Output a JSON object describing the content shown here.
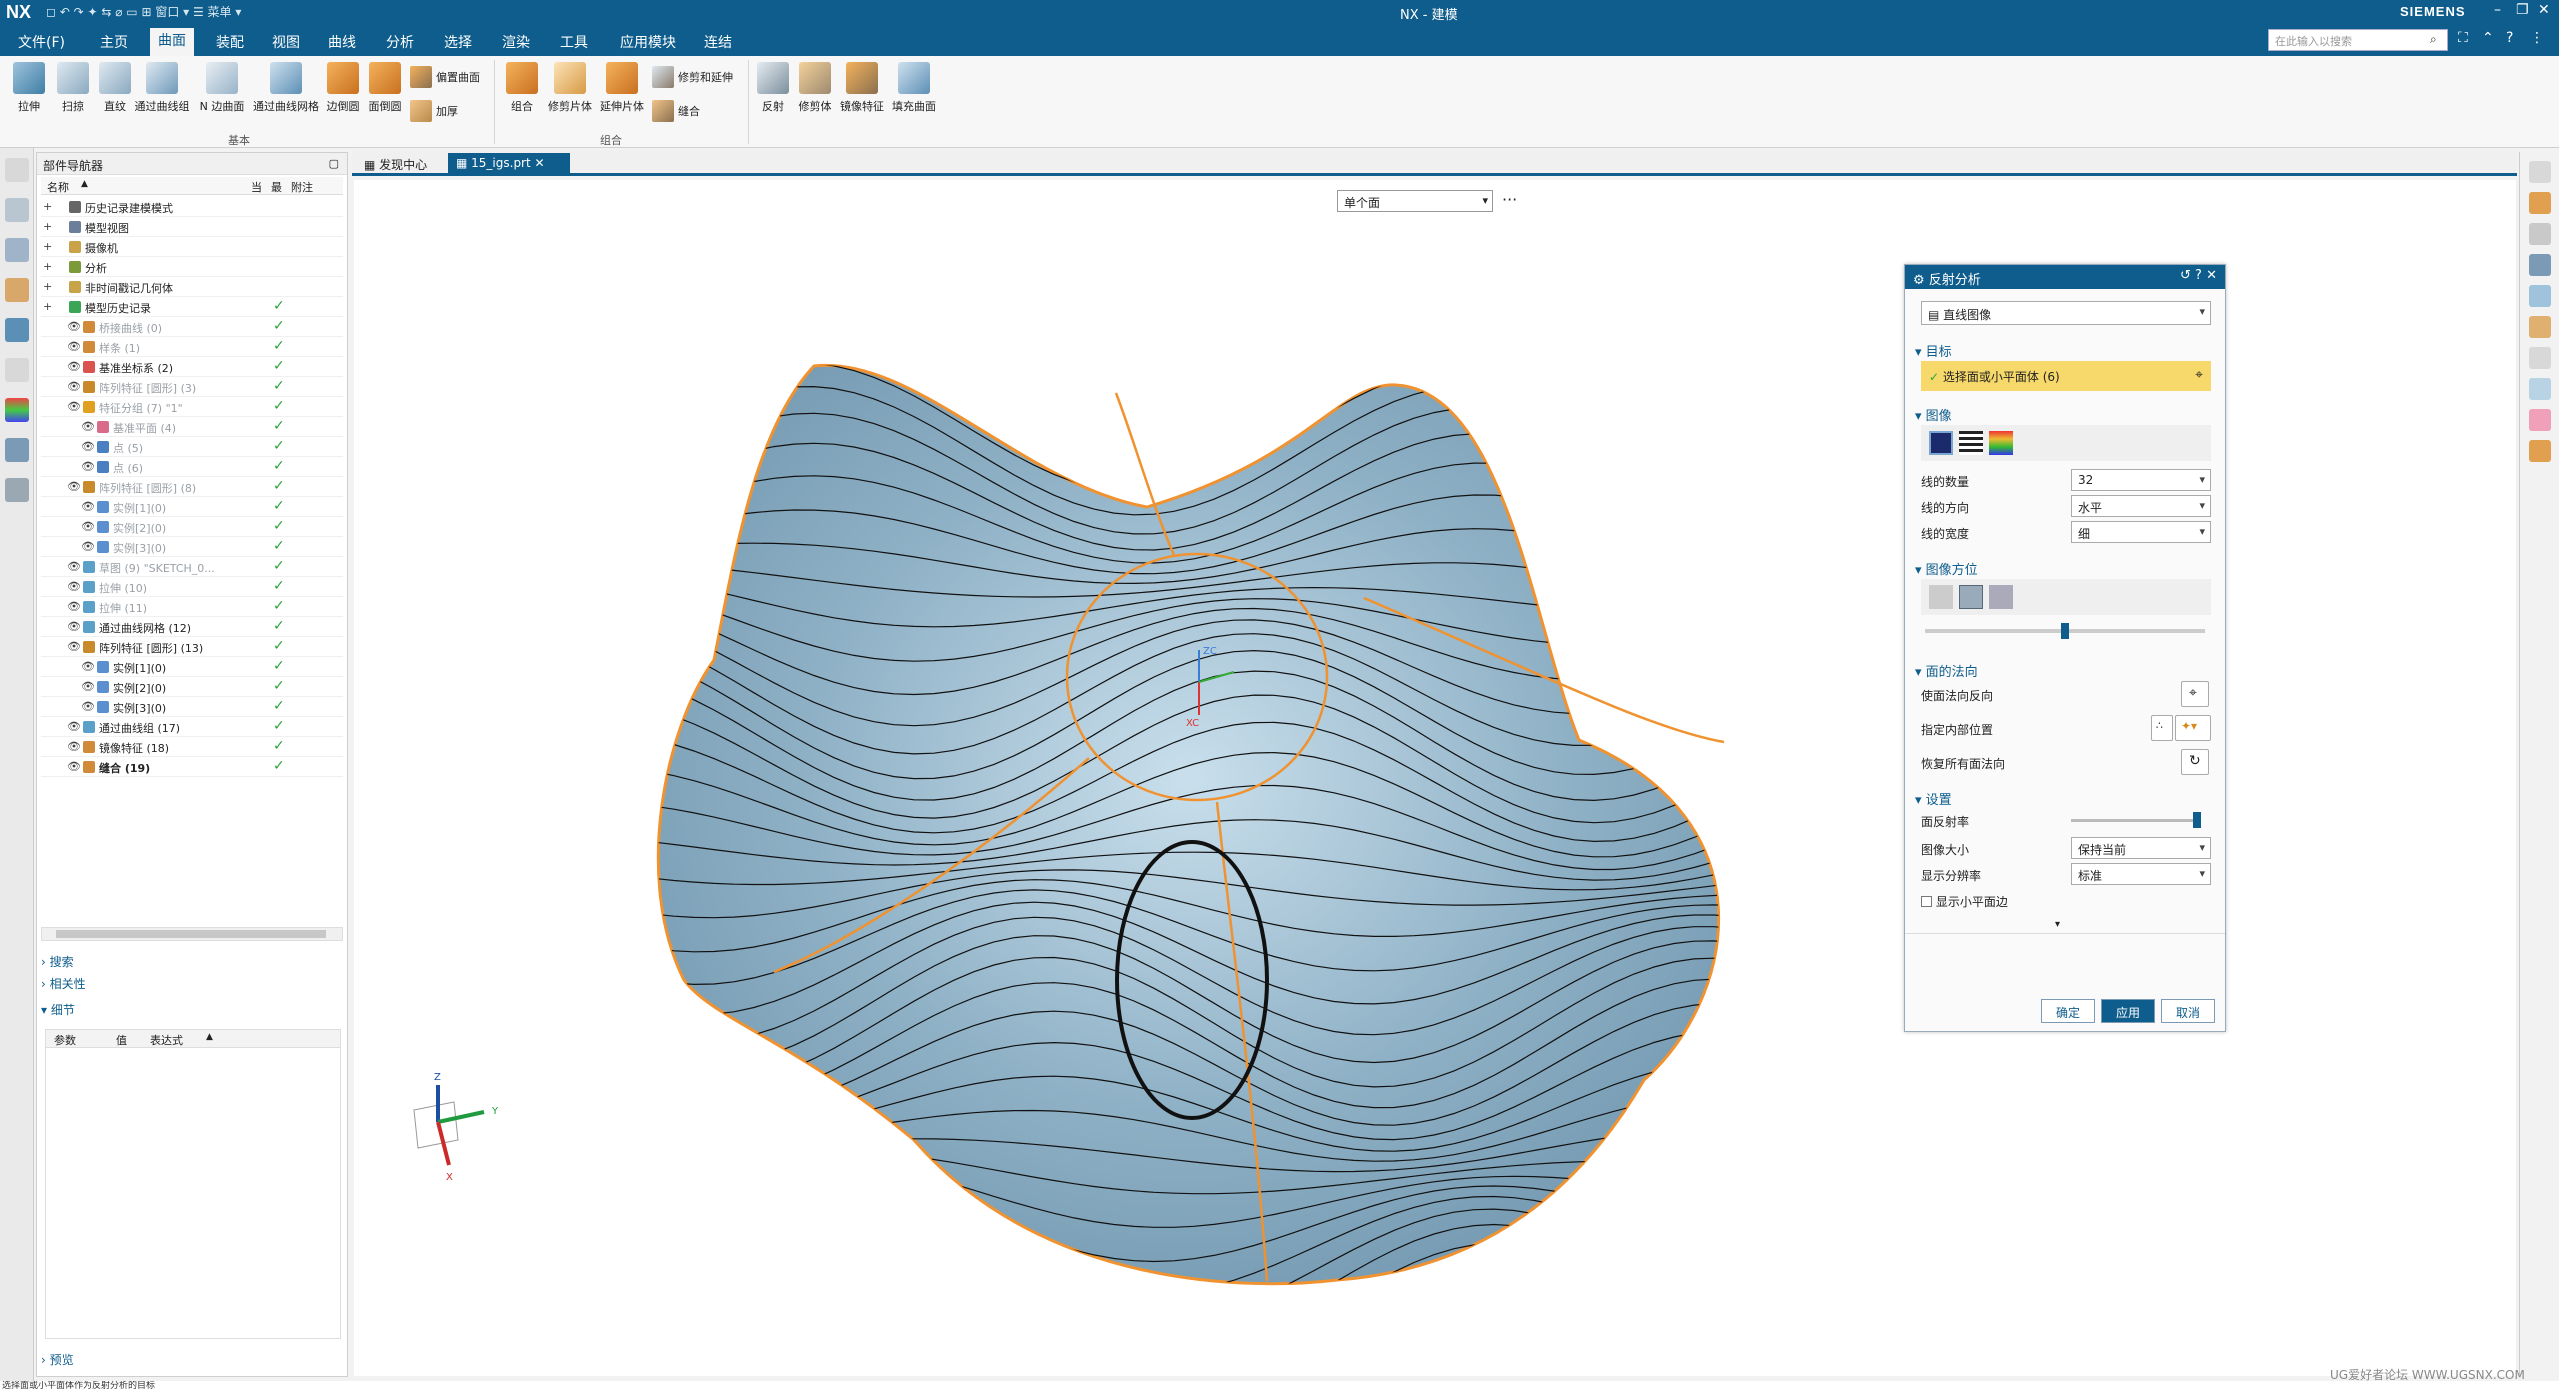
{
  "window": {
    "app": "NX",
    "title": "NX - 建模",
    "brand": "SIEMENS",
    "quick_access": "◻ ↶ ↷ ✦ ⇆ ⌀ ▭ ⊞ 窗口 ▾ ☰ 菜单 ▾"
  },
  "menu": {
    "items": [
      "文件(F)",
      "主页",
      "曲面",
      "装配",
      "视图",
      "曲线",
      "分析",
      "选择",
      "渲染",
      "工具",
      "应用模块",
      "连结"
    ],
    "active_index": 2,
    "search_placeholder": "在此输入以搜索"
  },
  "ribbon": {
    "base_buttons": [
      "拉伸",
      "扫掠",
      "直纹",
      "通过曲线组",
      "N 边曲面",
      "通过曲线网格",
      "边倒圆",
      "面倒圆"
    ],
    "small_buttons": [
      "偏置曲面",
      "加厚"
    ],
    "base_group": "基本",
    "combine_buttons": [
      "组合",
      "修剪片体",
      "延伸片体"
    ],
    "combine_small": [
      "修剪和延伸",
      "缝合"
    ],
    "combine_group": "组合",
    "more_buttons": [
      "反射",
      "修剪体",
      "镜像特征",
      "填充曲面"
    ]
  },
  "navigator": {
    "title": "部件导航器",
    "columns": [
      "名称",
      "当",
      "最",
      "附注"
    ],
    "rows": [
      {
        "label": "历史记录建模模式",
        "indent": 0,
        "dim": false,
        "bold": false,
        "check": false,
        "color": "#666666"
      },
      {
        "label": "模型视图",
        "indent": 0,
        "dim": false,
        "bold": false,
        "check": false,
        "color": "#6b7f99"
      },
      {
        "label": "摄像机",
        "indent": 0,
        "dim": false,
        "bold": false,
        "check": false,
        "color": "#c9a24a"
      },
      {
        "label": "分析",
        "indent": 0,
        "dim": false,
        "bold": false,
        "check": false,
        "color": "#7c9a3a"
      },
      {
        "label": "非时间戳记几何体",
        "indent": 0,
        "dim": false,
        "bold": false,
        "check": false,
        "color": "#c7a44a"
      },
      {
        "label": "模型历史记录",
        "indent": 0,
        "dim": false,
        "bold": false,
        "check": true,
        "color": "#3aa655"
      },
      {
        "label": "桥接曲线 (0)",
        "indent": 1,
        "dim": true,
        "bold": false,
        "check": true,
        "color": "#d08a3a"
      },
      {
        "label": "样条 (1)",
        "indent": 1,
        "dim": true,
        "bold": false,
        "check": true,
        "color": "#d08a3a"
      },
      {
        "label": "基准坐标系 (2)",
        "indent": 1,
        "dim": false,
        "bold": false,
        "check": true,
        "color": "#d9534f"
      },
      {
        "label": "阵列特征 [圆形] (3)",
        "indent": 1,
        "dim": true,
        "bold": false,
        "check": true,
        "color": "#c88a2a"
      },
      {
        "label": "特征分组 (7) \"1\"",
        "indent": 1,
        "dim": true,
        "bold": false,
        "check": true,
        "color": "#e0a020"
      },
      {
        "label": "基准平面 (4)",
        "indent": 2,
        "dim": true,
        "bold": false,
        "check": true,
        "color": "#d96b8a"
      },
      {
        "label": "点 (5)",
        "indent": 2,
        "dim": true,
        "bold": false,
        "check": true,
        "color": "#4a7fc1"
      },
      {
        "label": "点 (6)",
        "indent": 2,
        "dim": true,
        "bold": false,
        "check": true,
        "color": "#4a7fc1"
      },
      {
        "label": "阵列特征 [圆形] (8)",
        "indent": 1,
        "dim": true,
        "bold": false,
        "check": true,
        "color": "#c88a2a"
      },
      {
        "label": "实例[1](0)",
        "indent": 2,
        "dim": true,
        "bold": false,
        "check": true,
        "color": "#5b8fd0"
      },
      {
        "label": "实例[2](0)",
        "indent": 2,
        "dim": true,
        "bold": false,
        "check": true,
        "color": "#5b8fd0"
      },
      {
        "label": "实例[3](0)",
        "indent": 2,
        "dim": true,
        "bold": false,
        "check": true,
        "color": "#5b8fd0"
      },
      {
        "label": "草图 (9) \"SKETCH_0...",
        "indent": 1,
        "dim": true,
        "bold": false,
        "check": true,
        "color": "#5aa0c8"
      },
      {
        "label": "拉伸 (10)",
        "indent": 1,
        "dim": true,
        "bold": false,
        "check": true,
        "color": "#5aa0c8"
      },
      {
        "label": "拉伸 (11)",
        "indent": 1,
        "dim": true,
        "bold": false,
        "check": true,
        "color": "#5aa0c8"
      },
      {
        "label": "通过曲线网格 (12)",
        "indent": 1,
        "dim": false,
        "bold": false,
        "check": true,
        "color": "#5aa0c8"
      },
      {
        "label": "阵列特征 [圆形] (13)",
        "indent": 1,
        "dim": false,
        "bold": false,
        "check": true,
        "color": "#c88a2a"
      },
      {
        "label": "实例[1](0)",
        "indent": 2,
        "dim": false,
        "bold": false,
        "check": true,
        "color": "#5b8fd0"
      },
      {
        "label": "实例[2](0)",
        "indent": 2,
        "dim": false,
        "bold": false,
        "check": true,
        "color": "#5b8fd0"
      },
      {
        "label": "实例[3](0)",
        "indent": 2,
        "dim": false,
        "bold": false,
        "check": true,
        "color": "#5b8fd0"
      },
      {
        "label": "通过曲线组 (17)",
        "indent": 1,
        "dim": false,
        "bold": false,
        "check": true,
        "color": "#5aa0c8"
      },
      {
        "label": "镜像特征 (18)",
        "indent": 1,
        "dim": false,
        "bold": false,
        "check": true,
        "color": "#d08a3a"
      },
      {
        "label": "缝合 (19)",
        "indent": 1,
        "dim": false,
        "bold": true,
        "check": true,
        "color": "#d08a3a"
      }
    ],
    "sections": [
      "搜索",
      "相关性",
      "细节",
      "预览"
    ],
    "detail_columns": [
      "参数",
      "值",
      "表达式"
    ]
  },
  "tabs": [
    {
      "label": "发现中心",
      "active": false
    },
    {
      "label": "15_igs.prt",
      "active": true
    }
  ],
  "viewport": {
    "filter_value": "单个面",
    "more_label": "···",
    "triad": {
      "x": "X",
      "y": "Y",
      "z": "Z"
    },
    "origin_axes": {
      "x": "XC",
      "z": "ZC"
    }
  },
  "dialog": {
    "title": "反射分析",
    "type_value": "直线图像",
    "target_section": "目标",
    "target_value": "选择面或小平面体 (6)",
    "image_section": "图像",
    "rows": [
      {
        "label": "线的数量",
        "value": "32"
      },
      {
        "label": "线的方向",
        "value": "水平"
      },
      {
        "label": "线的宽度",
        "value": "细"
      }
    ],
    "orientation_section": "图像方位",
    "orientation_slider": 0.5,
    "normal_section": "面的法向",
    "normal_rows": [
      "使面法向反向",
      "指定内部位置",
      "恢复所有面法向"
    ],
    "settings_section": "设置",
    "reflectivity_label": "面反射率",
    "reflectivity_level": 1.0,
    "settings_rows": [
      {
        "label": "图像大小",
        "value": "保持当前"
      },
      {
        "label": "显示分辨率",
        "value": "标准"
      }
    ],
    "show_facet_edges": "显示小平面边",
    "buttons": {
      "ok": "确定",
      "apply": "应用",
      "cancel": "取消"
    }
  },
  "status_text": "选择面或小平面体作为反射分析的目标",
  "watermark": "UG爱好者论坛 WWW.UGSNX.COM"
}
